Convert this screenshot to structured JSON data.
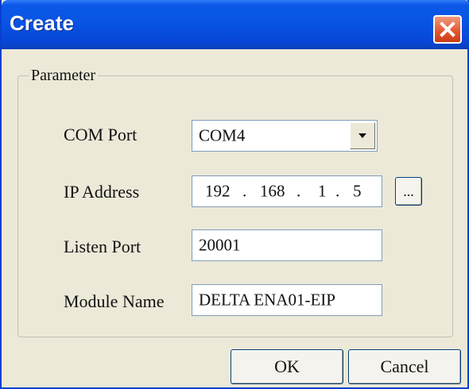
{
  "window": {
    "title": "Create",
    "close_icon": "close-icon"
  },
  "group": {
    "label": "Parameter"
  },
  "fields": {
    "com_port": {
      "label": "COM Port",
      "value": "COM4",
      "dropdown_icon": "chevron-down-icon"
    },
    "ip_address": {
      "label": "IP Address",
      "octets": [
        "192",
        "168",
        "1",
        "5"
      ],
      "separator": ".",
      "browse_label": "..."
    },
    "listen_port": {
      "label": "Listen Port",
      "value": "20001"
    },
    "module_name": {
      "label": "Module Name",
      "value": "DELTA ENA01-EIP"
    }
  },
  "buttons": {
    "ok": "OK",
    "cancel": "Cancel"
  },
  "colors": {
    "titlebar": "#0853e2",
    "close_button": "#e2552e",
    "face": "#ece9d8"
  }
}
